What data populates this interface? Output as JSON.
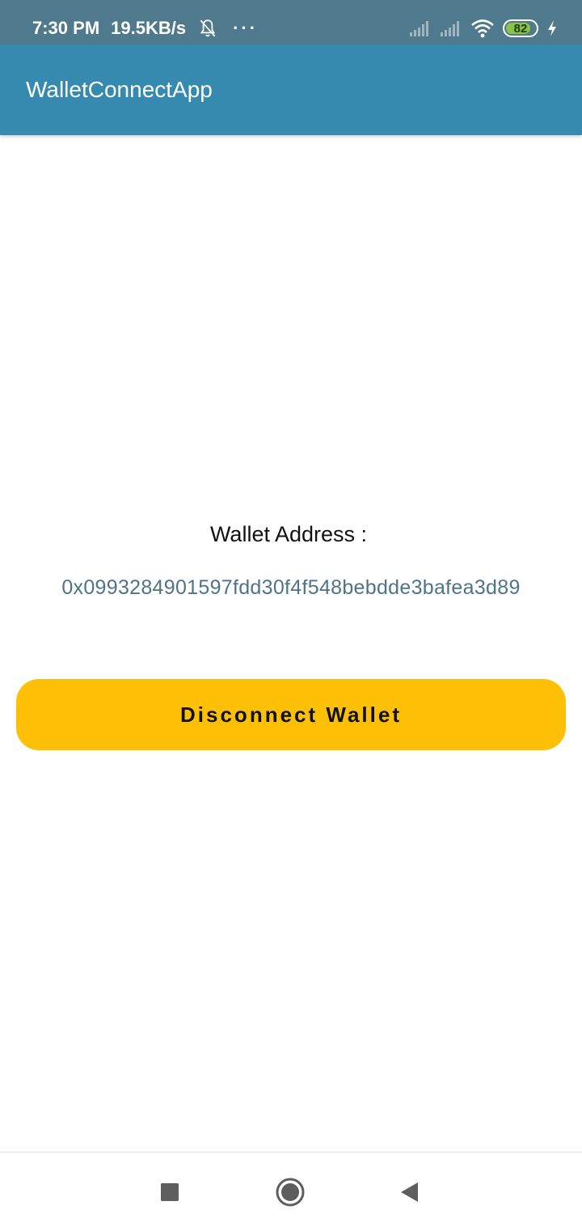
{
  "status_bar": {
    "time": "7:30 PM",
    "net_speed": "19.5KB/s",
    "more": "···",
    "battery_level": "82",
    "icons": [
      "bell-off-icon",
      "signal-icon",
      "signal-icon",
      "wifi-icon",
      "battery-icon",
      "charging-icon"
    ]
  },
  "app_bar": {
    "title": "WalletConnectApp"
  },
  "main": {
    "address_label": "Wallet Address :",
    "address_value": "0x0993284901597fdd30f4f548bebdde3bafea3d89",
    "disconnect_label": "Disconnect Wallet"
  },
  "colors": {
    "status_bar": "#4f7a8e",
    "app_bar": "#3689af",
    "address_text": "#4d7488",
    "button": "#fdc006"
  },
  "nav_bar": {
    "buttons": [
      "recents-icon",
      "home-icon",
      "back-icon"
    ]
  }
}
